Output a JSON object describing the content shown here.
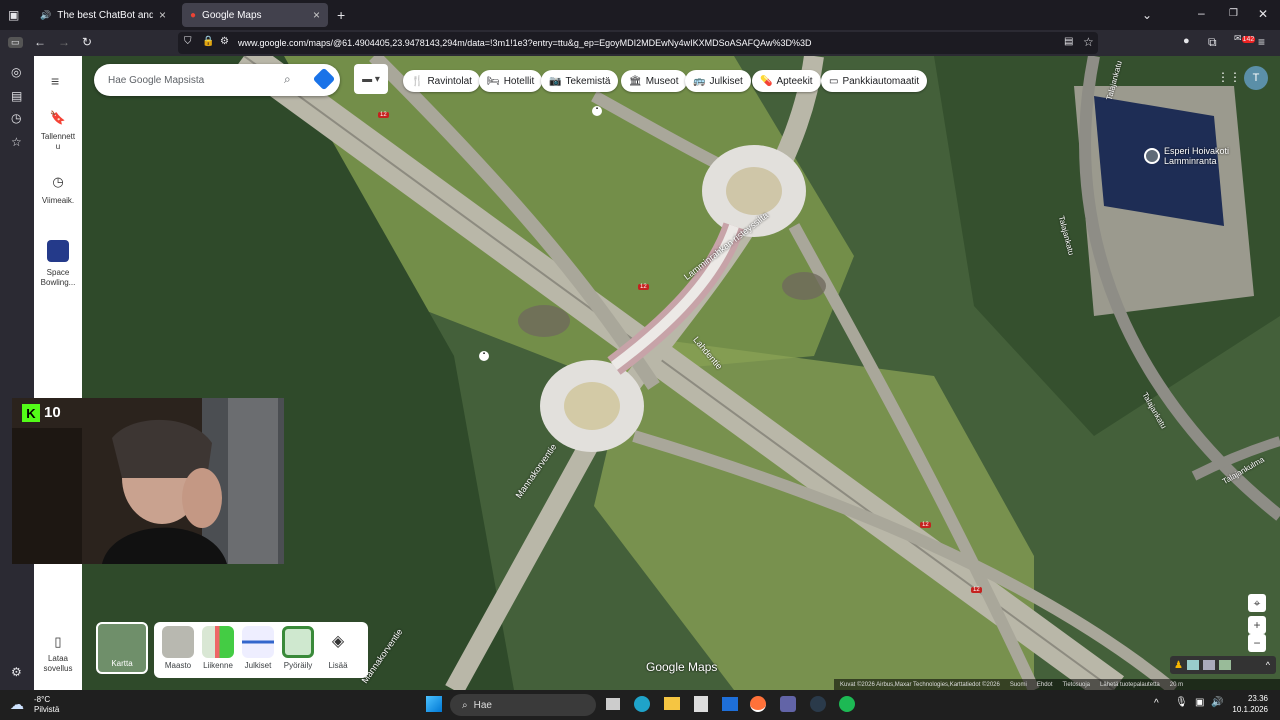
{
  "browser": {
    "tabs": [
      {
        "title": "The best ChatBot and Wid­",
        "active": false
      },
      {
        "title": "Google Maps",
        "active": true
      }
    ],
    "url": "www.google.com/maps/@61.4904405,23.9478143,294m/data=!3m1!1e3?entry=ttu&g_ep=EgoyMDI2MDEwNy4wIKXMDSoASAFQAw%3D%3D",
    "badge_count": "142"
  },
  "maps": {
    "search_placeholder": "Hae Google Mapsista",
    "sidebar": [
      {
        "label": "Tallennett\nu",
        "icon": "bookmark-icon"
      },
      {
        "label": "Viimeaik.",
        "icon": "history-icon"
      },
      {
        "label": "Space Bowling...",
        "icon": "place-thumb"
      },
      {
        "label": "Lataa sovellus",
        "icon": "phone-icon"
      }
    ],
    "chips": [
      "Ravintolat",
      "Hotellit",
      "Tekemistä",
      "Museot",
      "Julkiset",
      "Apteekit",
      "Pankkiautomaatit"
    ],
    "layers": [
      {
        "label": "Kartta"
      },
      {
        "label": "Maasto"
      },
      {
        "label": "Liikenne"
      },
      {
        "label": "Julkiset"
      },
      {
        "label": "Pyöräily"
      },
      {
        "label": "Lisää"
      }
    ],
    "place_label": "Esperi Hoivakoti Lamminranta",
    "road_labels": [
      "Lamminrahkan risteyssilta",
      "Lahdentie",
      "Mannakorventie",
      "Mannakorventie",
      "Talajankatu",
      "Talajankatu",
      "Talajankulma",
      "Talajankatu"
    ],
    "road_numbers": [
      "12",
      "12",
      "12",
      "12"
    ],
    "watermark": "Google Maps",
    "attribution": "Kuvat ©2026 Airbus,Maxar Technologies,Karttatiedot ©2026",
    "footer_links": [
      "Suomi",
      "Ehdot",
      "Tietosuoja",
      "Lähetä tuotepalautetta"
    ],
    "scale": "20 m"
  },
  "stream": {
    "logo": "K",
    "number": "10"
  },
  "taskbar": {
    "weather_temp": "-8°C",
    "weather_desc": "Pilvistä",
    "search_label": "Hae",
    "time": "23.36",
    "date": "10.1.2026"
  }
}
